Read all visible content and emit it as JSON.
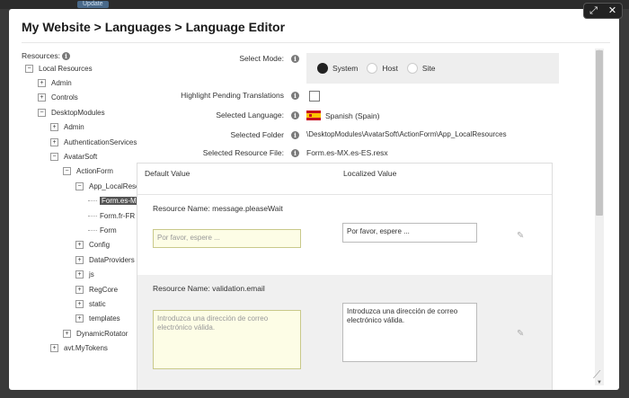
{
  "topbar": {
    "tag": "Update"
  },
  "window_controls": {
    "maximize": "⤢",
    "close": "✕"
  },
  "dialog": {
    "title": "My Website > Languages > Language Editor"
  },
  "resources": {
    "label": "Resources:",
    "tree": [
      {
        "label": "Local Resources",
        "level": 0,
        "toggle": "−"
      },
      {
        "label": "Admin",
        "level": 1,
        "toggle": "+"
      },
      {
        "label": "Controls",
        "level": 1,
        "toggle": "+"
      },
      {
        "label": "DesktopModules",
        "level": 1,
        "toggle": "−"
      },
      {
        "label": "Admin",
        "level": 2,
        "toggle": "+"
      },
      {
        "label": "AuthenticationServices",
        "level": 2,
        "toggle": "+"
      },
      {
        "label": "AvatarSoft",
        "level": 2,
        "toggle": "−"
      },
      {
        "label": "ActionForm",
        "level": 3,
        "toggle": "−"
      },
      {
        "label": "App_LocalResources",
        "level": 4,
        "toggle": "−"
      },
      {
        "label": "Form.es-MX",
        "level": 5,
        "toggle": "",
        "selected": true
      },
      {
        "label": "Form.fr-FR",
        "level": 5,
        "toggle": ""
      },
      {
        "label": "Form",
        "level": 5,
        "toggle": ""
      },
      {
        "label": "Config",
        "level": 4,
        "toggle": "+"
      },
      {
        "label": "DataProviders",
        "level": 4,
        "toggle": "+"
      },
      {
        "label": "js",
        "level": 4,
        "toggle": "+"
      },
      {
        "label": "RegCore",
        "level": 4,
        "toggle": "+"
      },
      {
        "label": "static",
        "level": 4,
        "toggle": "+"
      },
      {
        "label": "templates",
        "level": 4,
        "toggle": "+"
      },
      {
        "label": "DynamicRotator",
        "level": 3,
        "toggle": "+"
      },
      {
        "label": "avt.MyTokens",
        "level": 2,
        "toggle": "+"
      }
    ]
  },
  "form": {
    "select_mode": {
      "label": "Select Mode:",
      "options": [
        {
          "label": "System",
          "selected": true
        },
        {
          "label": "Host",
          "selected": false
        },
        {
          "label": "Site",
          "selected": false
        }
      ]
    },
    "highlight_pending": {
      "label": "Highlight Pending Translations",
      "checked": false
    },
    "selected_language": {
      "label": "Selected Language:",
      "value": "Spanish (Spain)",
      "flag": "es-flag"
    },
    "selected_folder": {
      "label": "Selected Folder",
      "value": "\\DesktopModules\\AvatarSoft\\ActionForm\\App_LocalResources"
    },
    "selected_file": {
      "label": "Selected Resource File:",
      "value": "Form.es-MX.es-ES.resx"
    }
  },
  "grid": {
    "headers": {
      "default": "Default Value",
      "localized": "Localized Value"
    },
    "rows": [
      {
        "name_label": "Resource Name:",
        "name": "message.pleaseWait",
        "default_value": "Por favor, espere ...",
        "localized_value": "Por favor, espere ..."
      },
      {
        "name_label": "Resource Name:",
        "name": "validation.email",
        "default_value": "Introduzca una dirección de correo electrónico válida.",
        "localized_value": "Introduzca una dirección de correo electrónico válida."
      }
    ]
  },
  "colors": {
    "row_alt": "#f0f0f0",
    "default_input_bg": "#fdfde6",
    "selected_node": "#555555"
  },
  "icons": {
    "info": "info-icon",
    "edit": "pencil-icon",
    "resize": "resize-grip-icon"
  }
}
